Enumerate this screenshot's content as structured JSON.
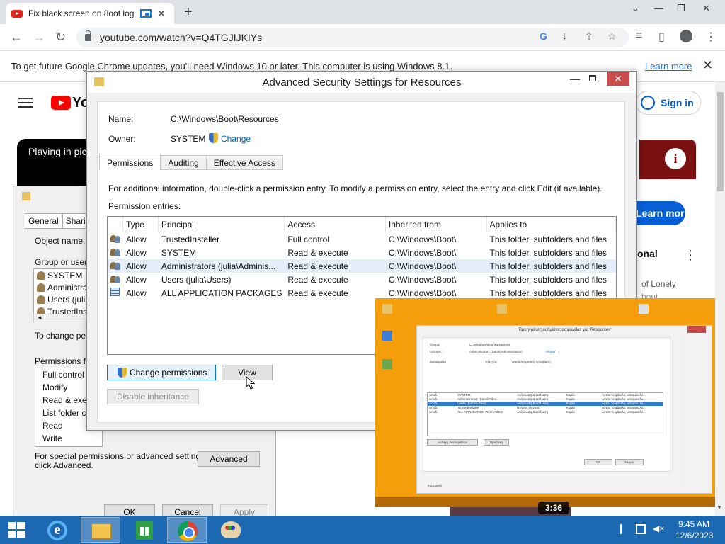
{
  "browser": {
    "tab_title": "Fix black screen on 8oot logo",
    "url": "youtube.com/watch?v=Q4TGJIJKIYs",
    "infobar_message": "To get future Google Chrome updates, you'll need Windows 10 or later. This computer is using Windows 8.1.",
    "infobar_link": "Learn more"
  },
  "youtube": {
    "logo_text": "Yo",
    "sign_in": "Sign in",
    "pip_text": "Playing in pic",
    "learn_more": "Learn more",
    "side_title": "onal",
    "side_line1": "of Lonely",
    "side_line2": "bout",
    "duration": "3:36"
  },
  "properties": {
    "tabs": [
      "General",
      "Sharing"
    ],
    "object_name_label": "Object name:",
    "group_label": "Group or user n",
    "groups": [
      "SYSTEM",
      "Administrat",
      "Users (julia",
      "TrustedInst"
    ],
    "change_perm_text": "To change pem",
    "permissions_label": "Permissions for",
    "perm_items": [
      "Full control",
      "Modify",
      "Read & execu",
      "List folder cor",
      "Read",
      "Write"
    ],
    "special_text_1": "For special permissions or advanced settings,",
    "special_text_2": "click Advanced.",
    "advanced_button": "Advanced",
    "ok": "OK",
    "cancel": "Cancel",
    "apply": "Apply"
  },
  "advanced": {
    "title": "Advanced Security Settings for Resources",
    "name_label": "Name:",
    "name_value": "C:\\Windows\\Boot\\Resources",
    "owner_label": "Owner:",
    "owner_value": "SYSTEM",
    "change_link": "Change",
    "tabs": [
      "Permissions",
      "Auditing",
      "Effective Access"
    ],
    "info_text": "For additional information, double-click a permission entry. To modify a permission entry, select the entry and click Edit (if available).",
    "entries_label": "Permission entries:",
    "columns": [
      "Type",
      "Principal",
      "Access",
      "Inherited from",
      "Applies to"
    ],
    "rows": [
      {
        "type": "Allow",
        "principal": "TrustedInstaller",
        "access": "Full control",
        "inherited": "C:\\Windows\\Boot\\",
        "applies": "This folder, subfolders and files",
        "icon": "users-icon"
      },
      {
        "type": "Allow",
        "principal": "SYSTEM",
        "access": "Read & execute",
        "inherited": "C:\\Windows\\Boot\\",
        "applies": "This folder, subfolders and files",
        "icon": "users-icon"
      },
      {
        "type": "Allow",
        "principal": "Administrators (julia\\Adminis...",
        "access": "Read & execute",
        "inherited": "C:\\Windows\\Boot\\",
        "applies": "This folder, subfolders and files",
        "icon": "users-icon"
      },
      {
        "type": "Allow",
        "principal": "Users (julia\\Users)",
        "access": "Read & execute",
        "inherited": "C:\\Windows\\Boot\\",
        "applies": "This folder, subfolders and files",
        "icon": "users-icon"
      },
      {
        "type": "Allow",
        "principal": "ALL APPLICATION PACKAGES",
        "access": "Read & execute",
        "inherited": "C:\\Windows\\Boot\\",
        "applies": "This folder, subfolders and files",
        "icon": "package-icon"
      }
    ],
    "change_permissions_button": "Change permissions",
    "view_button": "View",
    "disable_inheritance_button": "Disable inheritance"
  },
  "video": {
    "dialog_title": "Προηγμένες ρυθμίσεις ασφαλείας για 'Resources'",
    "name_label": "Όνομα:",
    "name_value": "C:\\Windows\\Boot\\Resources",
    "owner_label": "Κάτοχος:",
    "owner_value": "Administrators (Dubbi\\Administrators)",
    "change_link": "Αλλαγή",
    "tabs": [
      "Δικαιώματα",
      "Έλεγχος",
      "Αποτελεσματική πρόσβαση"
    ],
    "rows": [
      [
        "Αποδ.",
        "SYSTEM",
        "Ανάγνωση & εκτέλεση",
        "Καμία",
        "Αυτόν το φάκελο, υποφακέλο..."
      ],
      [
        "Αποδ.",
        "Administrators (Dubbi\\Admi...",
        "Ανάγνωση & εκτέλεση",
        "Καμία",
        "Αυτόν το φάκελο, υποφακέλο..."
      ],
      [
        "Αποδ.",
        "Users (Dubbi\\Users)",
        "Ανάγνωση & εκτέλεση",
        "Καμία",
        "Αυτόν το φάκελο, υποφακέλο..."
      ],
      [
        "Αποδ.",
        "TrustedInstaller",
        "Πλήρης έλεγχος",
        "Καμία",
        "Αυτόν το φάκελο, υποφακέλο..."
      ],
      [
        "Αποδ.",
        "ALL APPLICATION PACKAGES",
        "Ανάγνωση & εκτέλεση",
        "Καμία",
        "Αυτόν το φάκελο, υποφακέλο..."
      ]
    ],
    "change_button": "Αλλαγή δικαιωμάτων",
    "view_button": "Προβολή",
    "ok": "OK",
    "cancel": "Άκυρο",
    "status": "5 στοιχεία"
  },
  "taskbar": {
    "time": "9:45 AM",
    "date": "12/6/2023"
  },
  "colors": {
    "taskbar": "#1c69b1",
    "video_bg": "#f59e0c",
    "link": "#0066cc"
  }
}
